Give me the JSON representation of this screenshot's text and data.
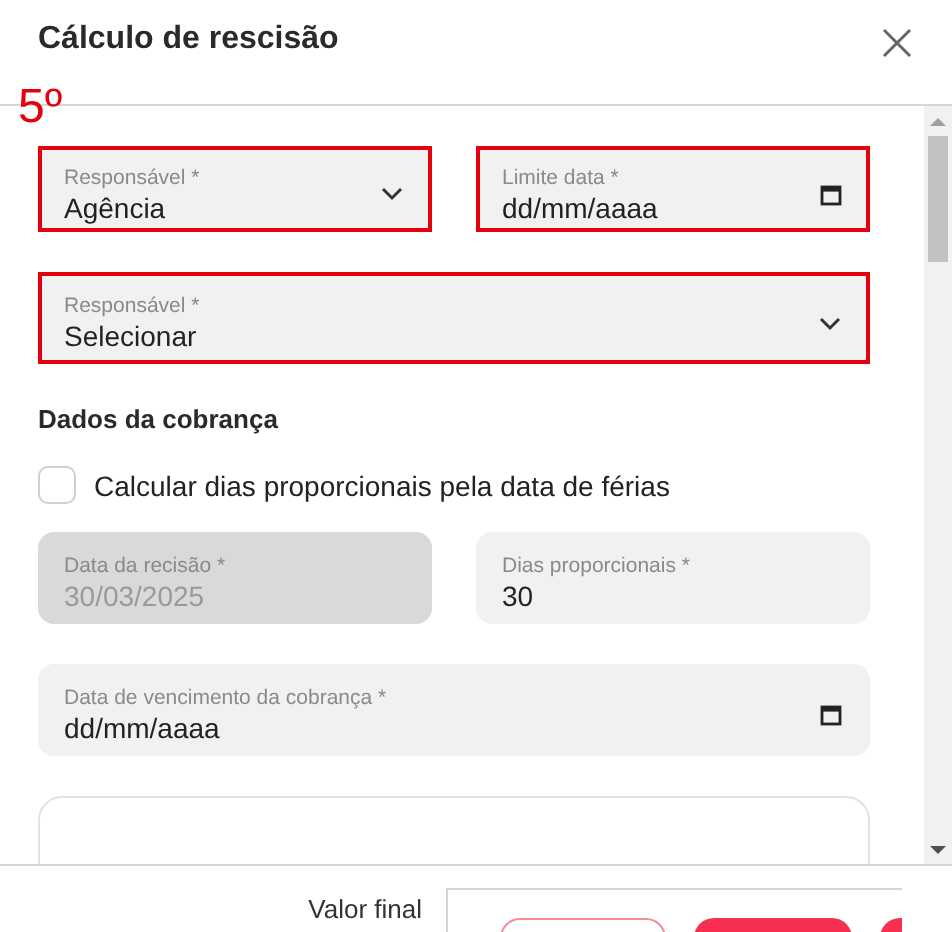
{
  "dialog": {
    "title": "Cálculo de rescisão"
  },
  "annotation": {
    "text": "5º"
  },
  "top_rows": [
    {
      "fields": [
        {
          "kind": "select",
          "label": "Responsável *",
          "value": "Agência",
          "highlighted": true,
          "disabled": false
        },
        {
          "kind": "date",
          "label": "Limite data *",
          "value": "dd/mm/aaaa",
          "highlighted": true,
          "disabled": false
        }
      ]
    },
    {
      "fields": [
        {
          "kind": "select",
          "label": "Responsável *",
          "value": "Selecionar",
          "highlighted": true,
          "disabled": false
        }
      ]
    }
  ],
  "billing": {
    "heading": "Dados da cobrança",
    "checkbox": {
      "label": "Calcular dias proporcionais pela data de férias",
      "checked": false
    },
    "rows": [
      {
        "fields": [
          {
            "kind": "text",
            "label": "Data da recisão *",
            "value": "30/03/2025",
            "highlighted": false,
            "disabled": true
          },
          {
            "kind": "text",
            "label": "Dias proporcionais *",
            "value": "30",
            "highlighted": false,
            "disabled": false
          }
        ]
      },
      {
        "fields": [
          {
            "kind": "date",
            "label": "Data de vencimento da cobrança *",
            "value": "dd/mm/aaaa",
            "highlighted": false,
            "disabled": false
          }
        ]
      }
    ]
  },
  "footer": {
    "label": "Valor final",
    "buttons": [
      {
        "kind": "outline"
      },
      {
        "kind": "filled"
      },
      {
        "kind": "filled"
      }
    ]
  }
}
